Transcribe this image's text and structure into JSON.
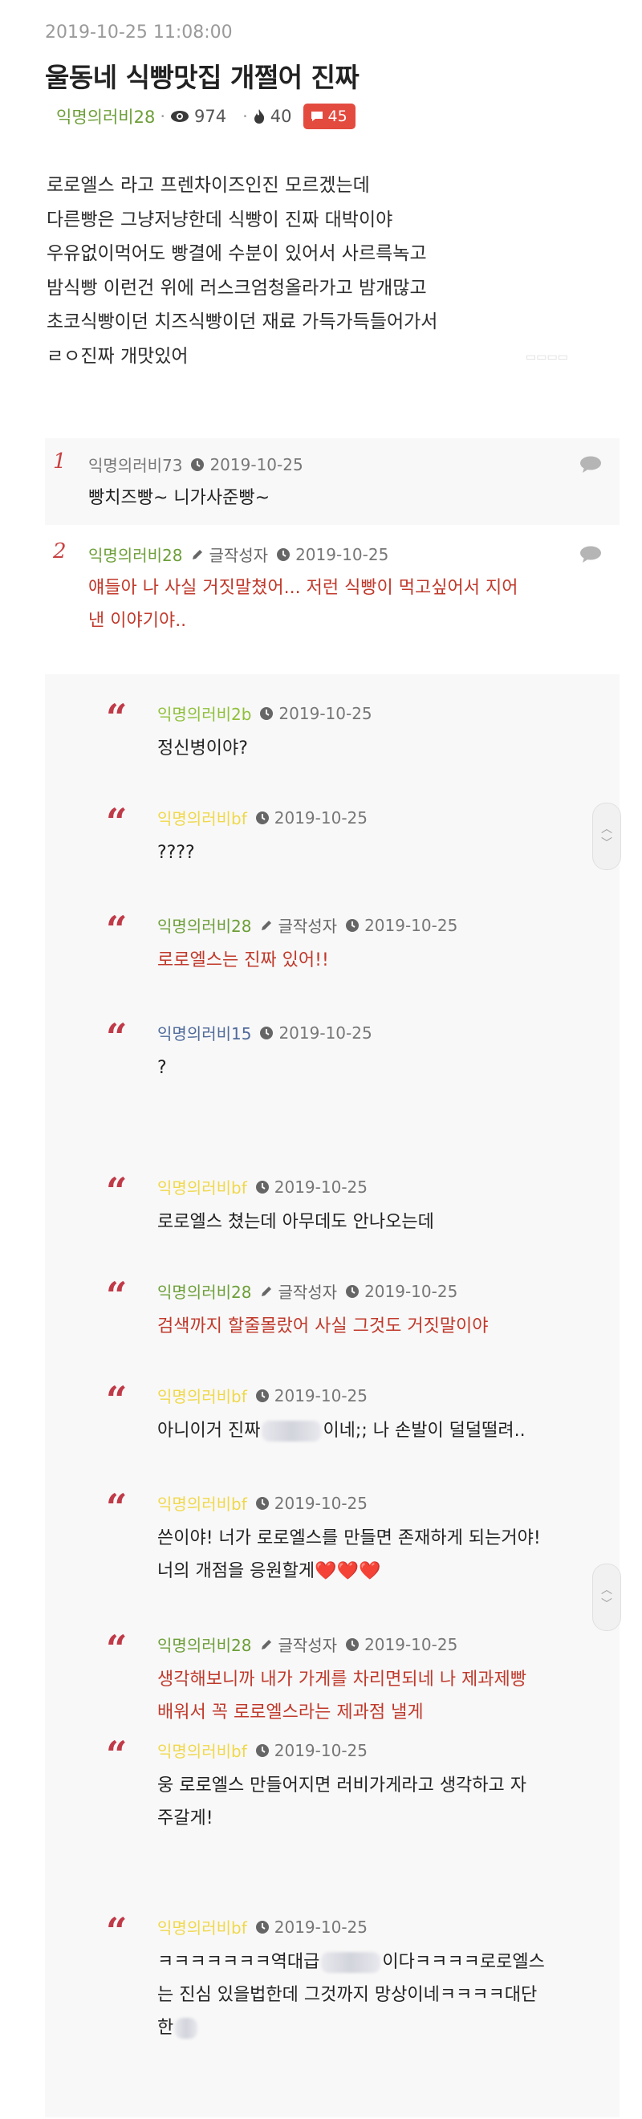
{
  "post": {
    "date": "2019-10-25 11:08:00",
    "title": "울동네 식빵맛집 개쩔어 진짜",
    "author": "익명의러비28",
    "views": "974",
    "likes": "40",
    "comments": "45",
    "body": [
      "로로엘스 라고 프렌차이즈인진 모르겠는데",
      "다른빵은 그냥저냥한데 식빵이 진짜 대박이야",
      "우유없이먹어도 빵결에 수분이 있어서 사르륵녹고",
      "밤식빵 이런건 위에 러스크엄청올라가고 밤개많고",
      "초코식빵이던 치즈식빵이던 재료 가득가득들어가서",
      "ㄹㅇ진짜 개맛있어"
    ]
  },
  "labels": {
    "writer_tag": "글작성자"
  },
  "comments": [
    {
      "num": "1",
      "nick": "익명의러비73",
      "nick_color": "#777777",
      "date": "2019-10-25",
      "lines": [
        "빵치즈빵~ 니가사준빵~"
      ]
    },
    {
      "num": "2",
      "nick": "익명의러비28",
      "nick_color": "#6d9e38",
      "date": "2019-10-25",
      "is_writer": true,
      "lines": [
        "얘들아 나 사실 거짓말쳤어... 저런 식빵이 먹고싶어서 지어",
        "낸 이야기야.."
      ]
    }
  ],
  "replies": [
    {
      "nick": "익명의러비2b",
      "nick_color": "#8fbf3a",
      "date": "2019-10-25",
      "lines": [
        "정신병이야?"
      ]
    },
    {
      "nick": "익명의러비bf",
      "nick_color": "#f0d84a",
      "date": "2019-10-25",
      "lines": [
        "????"
      ]
    },
    {
      "nick": "익명의러비28",
      "nick_color": "#6d9e38",
      "date": "2019-10-25",
      "is_writer": true,
      "lines": [
        "로로엘스는 진짜 있어!!"
      ]
    },
    {
      "nick": "익명의러비15",
      "nick_color": "#4f6a9a",
      "date": "2019-10-25",
      "lines": [
        "?"
      ]
    },
    {
      "nick": "익명의러비bf",
      "nick_color": "#f0d84a",
      "date": "2019-10-25",
      "lines": [
        "로로엘스 쳤는데 아무데도 안나오는데"
      ]
    },
    {
      "nick": "익명의러비28",
      "nick_color": "#6d9e38",
      "date": "2019-10-25",
      "is_writer": true,
      "lines": [
        "검색까지 할줄몰랐어 사실 그것도 거짓말이야"
      ]
    },
    {
      "nick": "익명의러비bf",
      "nick_color": "#f0d84a",
      "date": "2019-10-25",
      "lines": [
        "아니이거 진짜",
        "이네;; 나 손발이 덜덜떨려.."
      ]
    },
    {
      "nick": "익명의러비bf",
      "nick_color": "#f0d84a",
      "date": "2019-10-25",
      "lines": [
        "쓴이야! 너가 로로엘스를 만들면 존재하게 되는거야!",
        "너의 개점을 응원할게"
      ],
      "hearts": "❤️❤️❤️"
    },
    {
      "nick": "익명의러비28",
      "nick_color": "#6d9e38",
      "date": "2019-10-25",
      "is_writer": true,
      "lines": [
        "생각해보니까 내가 가게를 차리면되네 나 제과제빵",
        "배워서 꼭 로로엘스라는 제과점 낼게"
      ]
    },
    {
      "nick": "익명의러비bf",
      "nick_color": "#f0d84a",
      "date": "2019-10-25",
      "lines": [
        "웅 로로엘스 만들어지면 러비가게라고 생각하고 자",
        "주갈게!"
      ]
    },
    {
      "nick": "익명의러비bf",
      "nick_color": "#f0d84a",
      "date": "2019-10-25",
      "lines": [
        "ㅋㅋㅋㅋㅋㅋㅋ역대급",
        "이다ㅋㅋㅋㅋ로로엘스",
        "는 진심 있을법한데 그것까지 망상이네ㅋㅋㅋㅋ대단",
        "한"
      ]
    }
  ],
  "colors": {
    "accent_red": "#e34b3f",
    "op_text": "#c0392b",
    "quote_mark": "#c03a48"
  },
  "icons": [
    "eye-icon",
    "fire-icon",
    "comment-icon",
    "clock-icon",
    "pencil-icon",
    "reply-bubble-icon",
    "quote-mark-icon",
    "scroll-updown-icon"
  ]
}
